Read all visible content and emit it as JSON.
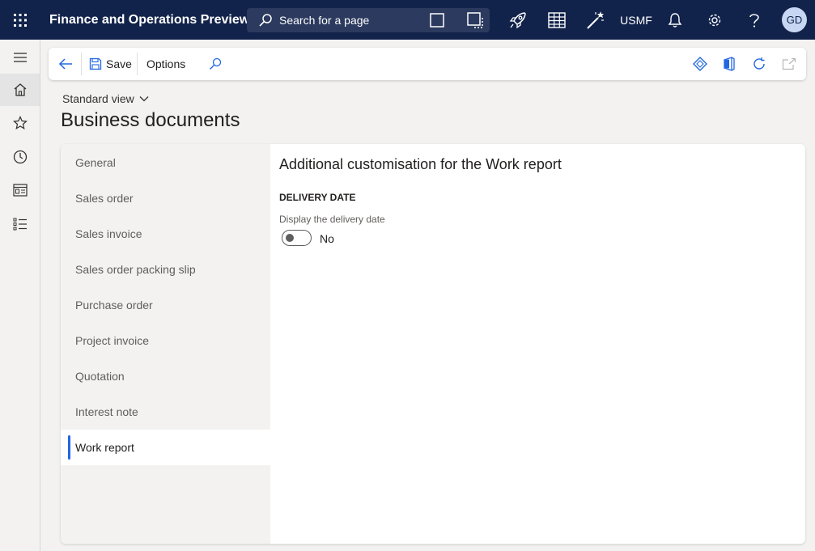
{
  "header": {
    "app_title": "Finance and Operations Preview",
    "search_placeholder": "Search for a page",
    "company": "USMF",
    "user_initials": "GD",
    "icons": [
      "waffle-icon",
      "search-icon",
      "square-icon",
      "select-square-icon",
      "rocket-icon",
      "grid-icon",
      "magic-wand-icon",
      "bell-icon",
      "gear-icon",
      "help-icon"
    ]
  },
  "rail": {
    "icons": [
      "hamburger-icon",
      "home-icon",
      "star-icon",
      "clock-icon",
      "workspace-icon",
      "list-icon"
    ]
  },
  "actionpane": {
    "save_label": "Save",
    "options_label": "Options",
    "icons": [
      "back-arrow-icon",
      "save-icon",
      "search-icon",
      "diamond-icon",
      "office-icon",
      "refresh-icon",
      "open-new-icon"
    ]
  },
  "page": {
    "view_label": "Standard view",
    "title": "Business documents"
  },
  "nav": {
    "items": [
      {
        "label": "General"
      },
      {
        "label": "Sales order"
      },
      {
        "label": "Sales invoice"
      },
      {
        "label": "Sales order packing slip"
      },
      {
        "label": "Purchase order"
      },
      {
        "label": "Project invoice"
      },
      {
        "label": "Quotation"
      },
      {
        "label": "Interest note"
      },
      {
        "label": "Work report"
      }
    ],
    "selected": "Work report"
  },
  "detail": {
    "section_title": "Additional customisation for the Work report",
    "group_title": "DELIVERY DATE",
    "field_label": "Display the delivery date",
    "toggle_on": false,
    "toggle_text": "No"
  },
  "colors": {
    "topbar": "#12234b",
    "accent": "#2266e3",
    "background": "#f3f2f1"
  }
}
